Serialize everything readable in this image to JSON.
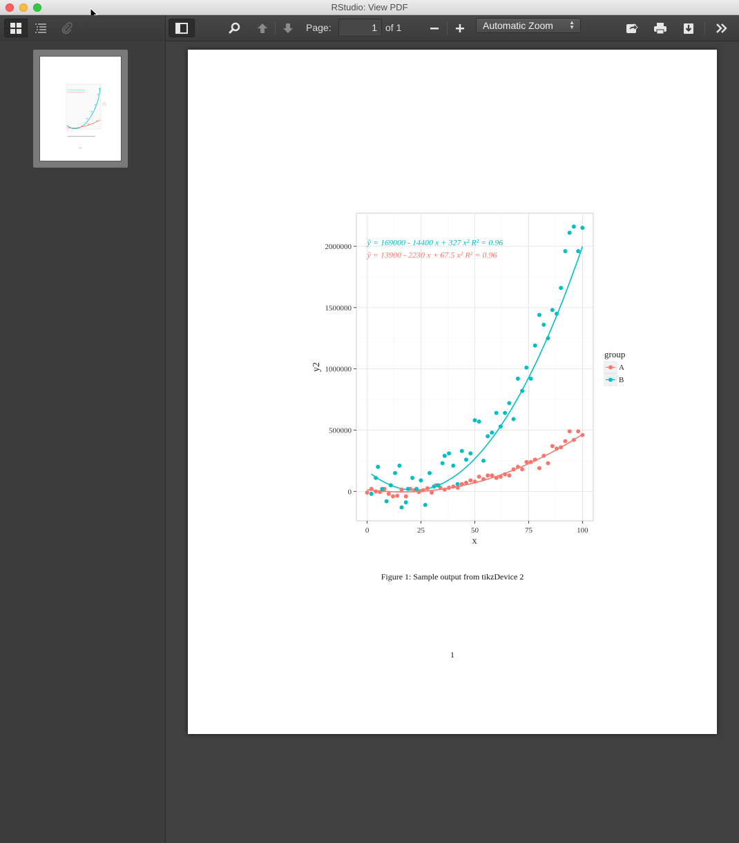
{
  "window": {
    "title": "RStudio: View PDF"
  },
  "toolbar": {
    "page_label": "Page:",
    "page_value": "1",
    "page_of": "of 1",
    "zoom": "Automatic Zoom"
  },
  "icons": {
    "thumbnails": "thumbnails-icon",
    "outline": "outline-icon",
    "attachments": "paperclip-icon",
    "sidebar_toggle": "sidebar-toggle-icon",
    "find": "search-icon",
    "prev": "arrow-up-icon",
    "next": "arrow-down-icon",
    "zoom_out": "minus-icon",
    "zoom_in": "plus-icon",
    "presentation": "presentation-icon",
    "print": "print-icon",
    "download": "download-icon",
    "more": "double-chevron-right-icon"
  },
  "document": {
    "caption": "Figure 1: Sample output from tikzDevice 2",
    "page_number": "1"
  },
  "chart_data": {
    "type": "scatter",
    "xlabel": "x",
    "ylabel": "y2",
    "xlim": [
      -5,
      105
    ],
    "ylim": [
      -240000,
      2270000
    ],
    "x_ticks": [
      0,
      25,
      50,
      75,
      100
    ],
    "y_ticks": [
      0,
      500000,
      1000000,
      1500000,
      2000000
    ],
    "grid": true,
    "legend": {
      "title": "group",
      "placement": "right",
      "entries": [
        "A",
        "B"
      ]
    },
    "colors": {
      "A": "#f8766d",
      "B": "#00bfc4"
    },
    "annotations": [
      {
        "group": "B",
        "text": "ŷ = 169000 - 14400 x + 327 x²     R² = 0.96",
        "x": 0,
        "y": 2030000
      },
      {
        "group": "A",
        "text": "ŷ = 13900 - 2230 x + 67.5 x²     R² = 0.96",
        "x": 0,
        "y": 1930000
      }
    ],
    "series": [
      {
        "name": "A",
        "fit": [
          13900,
          -2230,
          67.5
        ],
        "x": [
          0,
          2,
          4,
          6,
          8,
          10,
          12,
          14,
          16,
          18,
          20,
          22,
          24,
          26,
          28,
          30,
          32,
          34,
          36,
          38,
          40,
          42,
          44,
          46,
          48,
          50,
          52,
          54,
          56,
          58,
          60,
          62,
          64,
          66,
          68,
          70,
          72,
          74,
          76,
          78,
          80,
          82,
          84,
          86,
          88,
          90,
          92,
          94,
          96,
          98,
          100
        ],
        "y": [
          -10000,
          20000,
          0,
          -5000,
          20000,
          -20000,
          -40000,
          -35000,
          15000,
          -40000,
          20000,
          10000,
          -5000,
          10000,
          25000,
          -10000,
          50000,
          30000,
          15000,
          30000,
          40000,
          30000,
          60000,
          70000,
          90000,
          80000,
          120000,
          100000,
          130000,
          130000,
          110000,
          120000,
          140000,
          130000,
          180000,
          200000,
          180000,
          240000,
          240000,
          260000,
          190000,
          290000,
          230000,
          370000,
          350000,
          360000,
          410000,
          490000,
          420000,
          490000,
          460000
        ]
      },
      {
        "name": "B",
        "fit": [
          169000,
          -14400,
          327
        ],
        "x": [
          2,
          4,
          5,
          7,
          9,
          11,
          13,
          15,
          16,
          18,
          19,
          21,
          23,
          25,
          27,
          29,
          31,
          33,
          35,
          36,
          38,
          40,
          42,
          44,
          46,
          48,
          50,
          52,
          54,
          56,
          58,
          60,
          62,
          64,
          66,
          68,
          70,
          72,
          74,
          76,
          78,
          80,
          82,
          84,
          86,
          88,
          90,
          92,
          94,
          96,
          98,
          100
        ],
        "y": [
          -20000,
          110000,
          200000,
          20000,
          -80000,
          50000,
          150000,
          210000,
          -130000,
          -90000,
          20000,
          110000,
          20000,
          90000,
          -110000,
          150000,
          40000,
          50000,
          230000,
          290000,
          310000,
          210000,
          60000,
          330000,
          260000,
          310000,
          580000,
          570000,
          250000,
          450000,
          480000,
          640000,
          530000,
          640000,
          720000,
          590000,
          920000,
          820000,
          1010000,
          920000,
          1190000,
          1440000,
          1360000,
          1250000,
          1480000,
          1450000,
          1660000,
          1960000,
          2110000,
          2160000,
          1960000,
          2150000
        ]
      }
    ]
  }
}
